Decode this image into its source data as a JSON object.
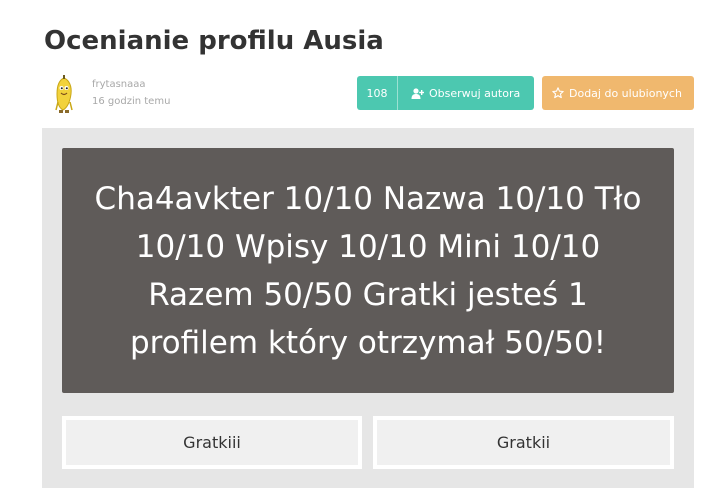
{
  "page": {
    "title": "Ocenianie profilu Ausia"
  },
  "author": {
    "name": "frytasnaaa",
    "time": "16 godzin temu",
    "avatar_icon": "banana-character-icon"
  },
  "actions": {
    "count": "108",
    "follow_label": "Obserwuj autora",
    "follow_icon": "user-plus-icon",
    "favorite_label": "Dodaj do ulubionych",
    "favorite_icon": "star-outline-icon"
  },
  "question": {
    "text": "Cha4avkter 10/10 Nazwa 10/10 Tło 10/10 Wpisy 10/10 Mini 10/10 Razem 50/50 Gratki jesteś 1 profilem który otrzymał 50/50!"
  },
  "answers": [
    {
      "label": "Gratkiii"
    },
    {
      "label": "Gratkii"
    }
  ],
  "colors": {
    "accent_teal": "#4cc8b0",
    "accent_orange": "#f0b86e",
    "question_bg": "#5f5b59",
    "panel_bg": "#e6e6e6"
  }
}
